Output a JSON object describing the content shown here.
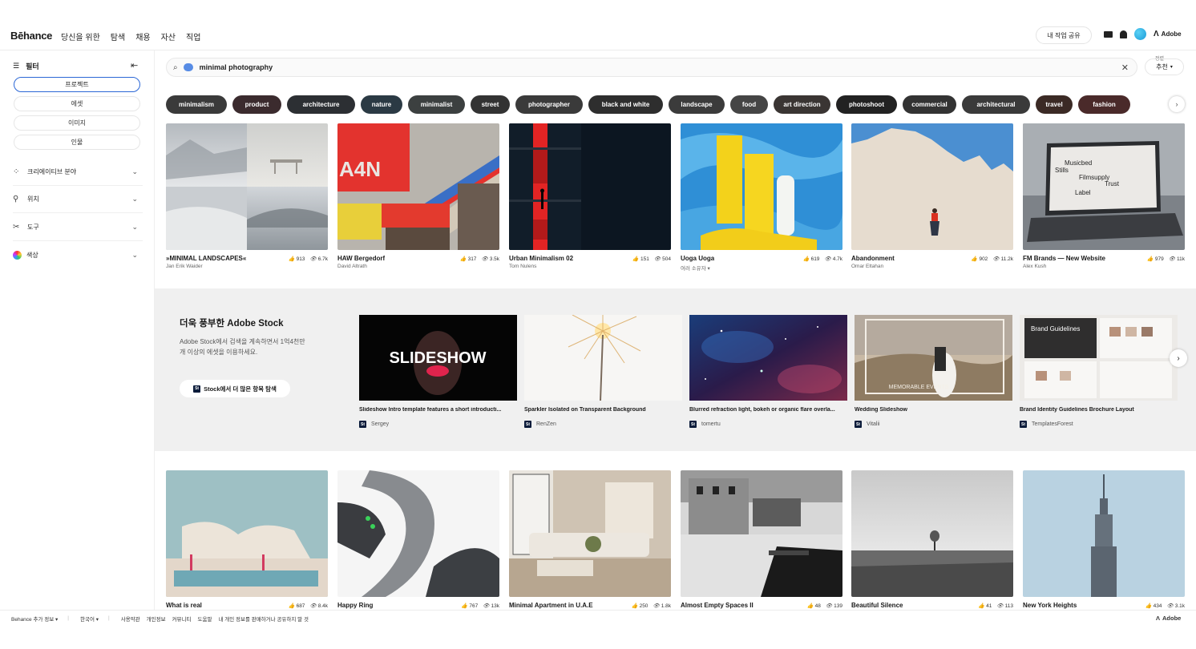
{
  "header": {
    "logo": "Bēhance",
    "nav": [
      "당신을 위한",
      "탐색",
      "채용",
      "자산",
      "직업"
    ],
    "share_label": "내 작업 공유",
    "adobe_label": "Adobe"
  },
  "sidebar": {
    "filter_label": "필터",
    "tabs": [
      "프로젝트",
      "에셋",
      "이미지",
      "인물"
    ],
    "sections": [
      "크리에이티브 분야",
      "위치",
      "도구",
      "색상"
    ]
  },
  "search": {
    "query": "minimal photography",
    "sort_label": "정렬",
    "sort_value": "추천"
  },
  "tags": [
    "minimalism",
    "product",
    "architecture",
    "nature",
    "minimalist",
    "street",
    "photographer",
    "black and white",
    "landscape",
    "food",
    "art direction",
    "photoshoot",
    "commercial",
    "architectural",
    "travel",
    "fashion"
  ],
  "tag_colors": [
    "#3a3a3a",
    "#3b2b2e",
    "#2c2f33",
    "#2b3a44",
    "#3c4040",
    "#333",
    "#3a3a3a",
    "#2e2e2e",
    "#3b3b3b",
    "#454545",
    "#3a3533",
    "#222",
    "#333",
    "#3a3a3a",
    "#3b2a25",
    "#4a2a2a"
  ],
  "projects": [
    {
      "title": "»MINIMAL LANDSCAPES«",
      "owner": "Jan Erik Waider",
      "likes": "913",
      "views": "6.7k"
    },
    {
      "title": "HAW Bergedorf",
      "owner": "David Altrath",
      "likes": "317",
      "views": "3.5k"
    },
    {
      "title": "Urban Minimalism 02",
      "owner": "Tom Nulens",
      "likes": "151",
      "views": "504"
    },
    {
      "title": "Uoga Uoga",
      "owner": "여러 소유자",
      "likes": "619",
      "views": "4.7k"
    },
    {
      "title": "Abandonment",
      "owner": "Omar Eltahan",
      "likes": "902",
      "views": "11.2k"
    },
    {
      "title": "FM Brands — New Website",
      "owner": "Alex Kush",
      "likes": "979",
      "views": "11k"
    },
    {
      "title": "What is real",
      "owner": "",
      "likes": "687",
      "views": "8.4k"
    },
    {
      "title": "Happy Ring",
      "owner": "",
      "likes": "767",
      "views": "13k"
    },
    {
      "title": "Minimal Apartment in U.A.E",
      "owner": "",
      "likes": "250",
      "views": "1.8k"
    },
    {
      "title": "Almost Empty Spaces II",
      "owner": "",
      "likes": "48",
      "views": "139"
    },
    {
      "title": "Beautiful Silence",
      "owner": "",
      "likes": "41",
      "views": "113"
    },
    {
      "title": "New York Heights",
      "owner": "",
      "likes": "434",
      "views": "3.1k"
    }
  ],
  "stock": {
    "title": "더욱 풍부한 Adobe Stock",
    "description": "Adobe Stock에서 검색을 계속하면서 1억4천만 개 이상의 에셋을 이용하세요.",
    "button_label": "Stock에서 더 많은 항목 탐색",
    "badge": "St",
    "items": [
      {
        "title": "Slideshow Intro template features a short introducti...",
        "author": "Sergey"
      },
      {
        "title": "Sparkler Isolated on Transparent Background",
        "author": "RenZen"
      },
      {
        "title": "Blurred refraction light, bokeh or organic flare overla...",
        "author": "tomertu"
      },
      {
        "title": "Wedding Slideshow",
        "author": "Vitalii"
      },
      {
        "title": "Brand Identity Guidelines Brochure Layout",
        "author": "TemplatesForest"
      }
    ],
    "slideshow_text": "SLIDESHOW",
    "wedding_text": "MEMORABLE EVENTS",
    "brand_text": "Brand Guidelines"
  },
  "laptop_words": [
    "Musicbed",
    "Stills",
    "Filmsupply",
    "Trust",
    "Label"
  ],
  "poster_text": "A4N",
  "footer": {
    "more": "Behance 추가 정보",
    "lang": "한국어",
    "links": [
      "사용약관",
      "개인정보",
      "커뮤니티",
      "도움말",
      "내 개인 정보를 판매하거나 공유하지 말 것"
    ],
    "adobe": "Adobe"
  }
}
